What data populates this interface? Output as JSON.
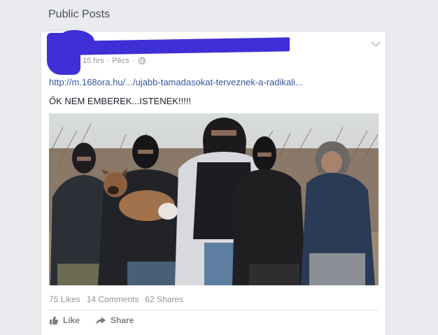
{
  "section": {
    "title": "Public Posts"
  },
  "post": {
    "meta": {
      "time": "15 hrs",
      "separator": "·",
      "location": "Pécs",
      "separator2": "·"
    },
    "link_text": "http://m.168ora.hu/.../ujabb-tamadasokat-terveznek-a-radikali...",
    "text": "ŐK NEM EMBEREK...ISTENEK!!!!!",
    "stats": {
      "likes": "75 Likes",
      "comments": "14 Comments",
      "shares": "62 Shares"
    },
    "actions": {
      "like": "Like",
      "share": "Share"
    }
  },
  "icons": {
    "menu": "chevron-down-icon",
    "privacy": "globe-icon",
    "like": "thumbs-up-icon",
    "share": "share-arrow-icon"
  },
  "colors": {
    "page_bg": "#e9ebee",
    "link": "#365899",
    "muted": "#90949c",
    "redaction": "#3f2fd6"
  }
}
